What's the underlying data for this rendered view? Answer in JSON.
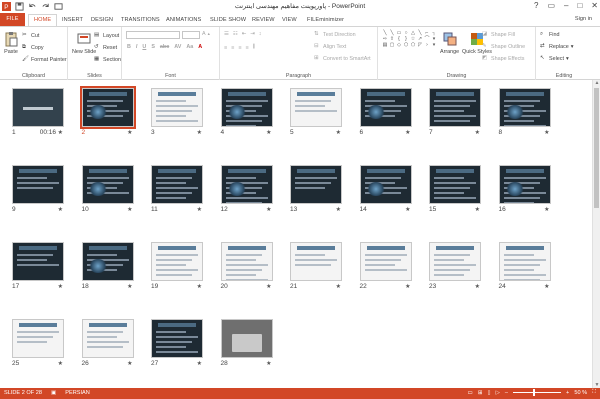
{
  "window": {
    "title": "پاورپوینت مفاهیم مهندسی اینترنت - PowerPoint"
  },
  "tabs": [
    "FILE",
    "HOME",
    "INSERT",
    "DESIGN",
    "TRANSITIONS",
    "ANIMATIONS",
    "SLIDE SHOW",
    "REVIEW",
    "VIEW",
    "FILEminimizer"
  ],
  "account": {
    "signin": "Sign in"
  },
  "ribbon": {
    "clipboard": {
      "label": "Clipboard",
      "paste": "Paste",
      "cut": "Cut",
      "copy": "Copy",
      "format_painter": "Format Painter"
    },
    "slides": {
      "label": "Slides",
      "new_slide": "New Slide",
      "layout": "Layout",
      "reset": "Reset",
      "section": "Section"
    },
    "font": {
      "label": "Font",
      "font_name": "",
      "font_size": ""
    },
    "paragraph": {
      "label": "Paragraph",
      "text_direction": "Text Direction",
      "align_text": "Align Text",
      "convert_smartart": "Convert to SmartArt"
    },
    "drawing": {
      "label": "Drawing",
      "arrange": "Arrange",
      "quick_styles": "Quick Styles",
      "shape_fill": "Shape Fill",
      "shape_outline": "Shape Outline",
      "shape_effects": "Shape Effects"
    },
    "editing": {
      "label": "Editing",
      "find": "Find",
      "replace": "Replace",
      "select": "Select"
    }
  },
  "slides": [
    {
      "num": "1",
      "timing": "00:16",
      "style": "title"
    },
    {
      "num": "2",
      "selected": true,
      "style": "dark"
    },
    {
      "num": "3",
      "style": "light"
    },
    {
      "num": "4",
      "style": "dark"
    },
    {
      "num": "5",
      "style": "light"
    },
    {
      "num": "6",
      "style": "dark"
    },
    {
      "num": "7",
      "style": "dark"
    },
    {
      "num": "8",
      "style": "dark"
    },
    {
      "num": "9",
      "style": "dark"
    },
    {
      "num": "10",
      "style": "dark"
    },
    {
      "num": "11",
      "style": "dark"
    },
    {
      "num": "12",
      "style": "dark"
    },
    {
      "num": "13",
      "style": "dark"
    },
    {
      "num": "14",
      "style": "dark"
    },
    {
      "num": "15",
      "style": "dark"
    },
    {
      "num": "16",
      "style": "dark"
    },
    {
      "num": "17",
      "style": "dark"
    },
    {
      "num": "18",
      "style": "dark"
    },
    {
      "num": "19",
      "style": "light"
    },
    {
      "num": "20",
      "style": "light"
    },
    {
      "num": "21",
      "style": "light"
    },
    {
      "num": "22",
      "style": "light"
    },
    {
      "num": "23",
      "style": "light"
    },
    {
      "num": "24",
      "style": "light"
    },
    {
      "num": "25",
      "style": "light"
    },
    {
      "num": "26",
      "style": "light"
    },
    {
      "num": "27",
      "style": "dark"
    },
    {
      "num": "28",
      "style": "photo"
    }
  ],
  "status": {
    "slide_info": "SLIDE 2 OF 28",
    "language": "PERSIAN",
    "zoom": "50 %"
  },
  "colors": {
    "accent": "#d24726",
    "selected_outline": "#d24726"
  }
}
